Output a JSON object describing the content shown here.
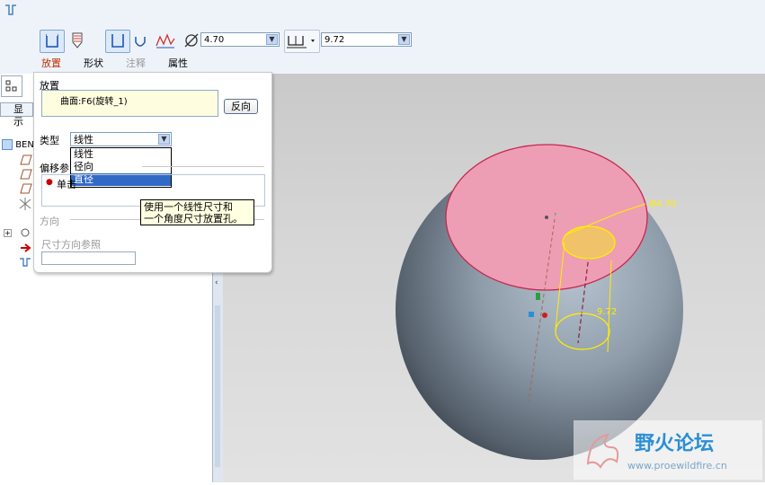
{
  "toolbar": {
    "diameter_value": "4.70",
    "depth_value": "9.72"
  },
  "tabs": [
    {
      "label": "放置",
      "state": "active"
    },
    {
      "label": "形状",
      "state": "normal"
    },
    {
      "label": "注释",
      "state": "disabled"
    },
    {
      "label": "属性",
      "state": "normal"
    }
  ],
  "left_pane": {
    "show_label": "显示",
    "tree_root": "BEN"
  },
  "placement": {
    "section_label": "放置",
    "surface_ref": "曲面:F6(旋转_1)",
    "flip_button": "反向",
    "type_label": "类型",
    "type_selected": "线性",
    "type_options": [
      "线性",
      "径向",
      "直径"
    ],
    "type_highlighted": "直径",
    "offset_label": "偏移参",
    "offset_item": "单击",
    "direction_label": "方向",
    "dim_dir_ref_label": "尺寸方向参照"
  },
  "tooltip": {
    "line1": "使用一个线性尺寸和",
    "line2": "一个角度尺寸放置孔。"
  },
  "viewport": {
    "dim_diameter": "Ø4.70",
    "dim_depth": "9.72"
  },
  "watermark": {
    "title": "野火论坛",
    "url": "www.proewildfire.cn"
  }
}
